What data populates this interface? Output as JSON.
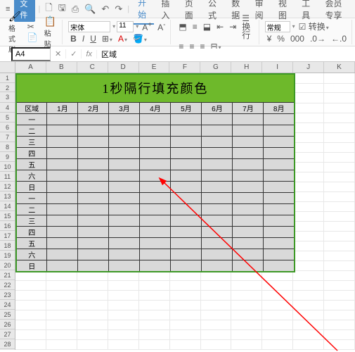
{
  "menubar": {
    "file": "文件",
    "tabs": [
      "开始",
      "插入",
      "页面",
      "公式",
      "数据",
      "审阅",
      "视图",
      "工具",
      "会员专享"
    ],
    "active_tab": 0
  },
  "ribbon": {
    "format_painter": "格式刷",
    "paste": "粘贴",
    "font_name": "宋体",
    "font_size": "11",
    "bold": "B",
    "italic": "I",
    "underline": "U",
    "wrap": "换行",
    "general": "常规",
    "convert": "转换"
  },
  "formula_bar": {
    "name_box": "A4",
    "fx": "fx",
    "value": "区域"
  },
  "columns": [
    "A",
    "B",
    "C",
    "D",
    "E",
    "F",
    "G",
    "H",
    "I",
    "J",
    "K"
  ],
  "rows": [
    "1",
    "2",
    "3",
    "4",
    "5",
    "6",
    "7",
    "8",
    "9",
    "10",
    "11",
    "12",
    "13",
    "14",
    "15",
    "16",
    "17",
    "18",
    "19",
    "20",
    "21",
    "22",
    "23",
    "24",
    "25",
    "26",
    "27",
    "28"
  ],
  "table": {
    "title": "1秒隔行填充颜色",
    "header_first": "区域",
    "months": [
      "1月",
      "2月",
      "3月",
      "4月",
      "5月",
      "6月",
      "7月",
      "8月"
    ],
    "row_labels_1": [
      "一",
      "二",
      "三",
      "四",
      "五",
      "六",
      "日"
    ],
    "row_labels_2": [
      "一",
      "二",
      "三",
      "四",
      "五",
      "六",
      "日"
    ]
  },
  "chart_data": {
    "type": "table",
    "title": "1秒隔行填充颜色",
    "columns": [
      "区域",
      "1月",
      "2月",
      "3月",
      "4月",
      "5月",
      "6月",
      "7月",
      "8月"
    ],
    "rows": [
      {
        "label": "一",
        "values": [
          "",
          "",
          "",
          "",
          "",
          "",
          "",
          ""
        ]
      },
      {
        "label": "二",
        "values": [
          "",
          "",
          "",
          "",
          "",
          "",
          "",
          ""
        ]
      },
      {
        "label": "三",
        "values": [
          "",
          "",
          "",
          "",
          "",
          "",
          "",
          ""
        ]
      },
      {
        "label": "四",
        "values": [
          "",
          "",
          "",
          "",
          "",
          "",
          "",
          ""
        ]
      },
      {
        "label": "五",
        "values": [
          "",
          "",
          "",
          "",
          "",
          "",
          "",
          ""
        ]
      },
      {
        "label": "六",
        "values": [
          "",
          "",
          "",
          "",
          "",
          "",
          "",
          ""
        ]
      },
      {
        "label": "日",
        "values": [
          "",
          "",
          "",
          "",
          "",
          "",
          "",
          ""
        ]
      },
      {
        "label": "一",
        "values": [
          "",
          "",
          "",
          "",
          "",
          "",
          "",
          ""
        ]
      },
      {
        "label": "二",
        "values": [
          "",
          "",
          "",
          "",
          "",
          "",
          "",
          ""
        ]
      },
      {
        "label": "三",
        "values": [
          "",
          "",
          "",
          "",
          "",
          "",
          "",
          ""
        ]
      },
      {
        "label": "四",
        "values": [
          "",
          "",
          "",
          "",
          "",
          "",
          "",
          ""
        ]
      },
      {
        "label": "五",
        "values": [
          "",
          "",
          "",
          "",
          "",
          "",
          "",
          ""
        ]
      },
      {
        "label": "六",
        "values": [
          "",
          "",
          "",
          "",
          "",
          "",
          "",
          ""
        ]
      },
      {
        "label": "日",
        "values": [
          "",
          "",
          "",
          "",
          "",
          "",
          "",
          ""
        ]
      }
    ]
  }
}
